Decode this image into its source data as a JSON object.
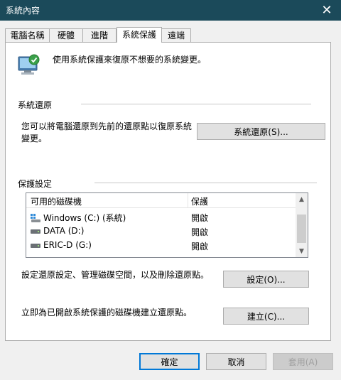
{
  "window": {
    "title": "系統內容",
    "close_glyph": "✕"
  },
  "tabs": [
    {
      "label": "電腦名稱",
      "active": false
    },
    {
      "label": "硬體",
      "active": false
    },
    {
      "label": "進階",
      "active": false
    },
    {
      "label": "系統保護",
      "active": true
    },
    {
      "label": "遠端",
      "active": false
    }
  ],
  "header": {
    "icon": "system-protection-icon",
    "text": "使用系統保護來復原不想要的系統變更。"
  },
  "restore_section": {
    "label": "系統還原",
    "description": "您可以將電腦還原到先前的還原點以復原系統變更。",
    "button": "系統還原(S)..."
  },
  "protection_section": {
    "label": "保護設定",
    "columns": {
      "drive": "可用的磁碟機",
      "protection": "保護"
    },
    "drives": [
      {
        "name": "Windows (C:) (系統)",
        "protection": "開啟",
        "icon": "system-drive-icon"
      },
      {
        "name": "DATA (D:)",
        "protection": "開啟",
        "icon": "drive-icon"
      },
      {
        "name": "ERIC-D (G:)",
        "protection": "開啟",
        "icon": "drive-icon"
      }
    ],
    "configure_text": "設定還原設定、管理磁碟空間，以及刪除還原點。",
    "configure_button": "設定(O)...",
    "create_text": "立即為已開啟系統保護的磁碟機建立還原點。",
    "create_button": "建立(C)..."
  },
  "footer": {
    "ok": "確定",
    "cancel": "取消",
    "apply": "套用(A)"
  }
}
